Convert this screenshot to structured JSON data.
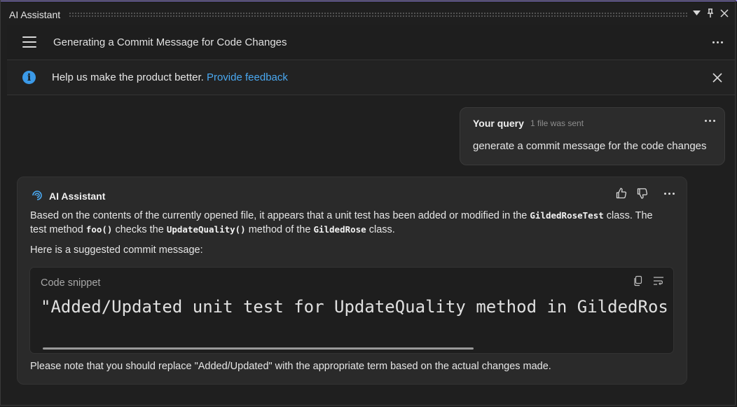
{
  "window": {
    "title": "AI Assistant"
  },
  "header": {
    "conversation_title": "Generating a Commit Message for Code Changes"
  },
  "banner": {
    "message": "Help us make the product better.",
    "link_text": "Provide feedback"
  },
  "query": {
    "label": "Your query",
    "meta": "1 file was sent",
    "text": "generate a commit message for the code changes"
  },
  "response": {
    "author": "AI Assistant",
    "para1_a": "Based on the contents of the currently opened file, it appears that a unit test has been added or modified in the ",
    "para1_class": "GildedRoseTest",
    "para1_b": " class. The",
    "para2_a": "test method ",
    "para2_method": "foo()",
    "para2_b": " checks the ",
    "para2_target": "UpdateQuality()",
    "para2_c": " method of the ",
    "para2_class": "GildedRose",
    "para2_d": " class.",
    "para3": "Here is a suggested commit message:",
    "snippet_label": "Code snippet",
    "snippet_code": "\"Added/Updated unit test for UpdateQuality method in GildedRos",
    "footer": "Please note that you should replace \"Added/Updated\" with the appropriate term based on the actual changes made."
  },
  "icons": {
    "info": "info-icon",
    "close": "close-icon",
    "menu": "hamburger-menu-icon",
    "assistant": "ai-assistant-logo-icon",
    "like": "thumbs-up-icon",
    "dislike": "thumbs-down-icon",
    "copy": "copy-icon",
    "wrap": "soft-wrap-icon"
  },
  "colors": {
    "accent": "#8a7ad8",
    "link": "#4aa8f0",
    "info": "#3b9ae8"
  }
}
